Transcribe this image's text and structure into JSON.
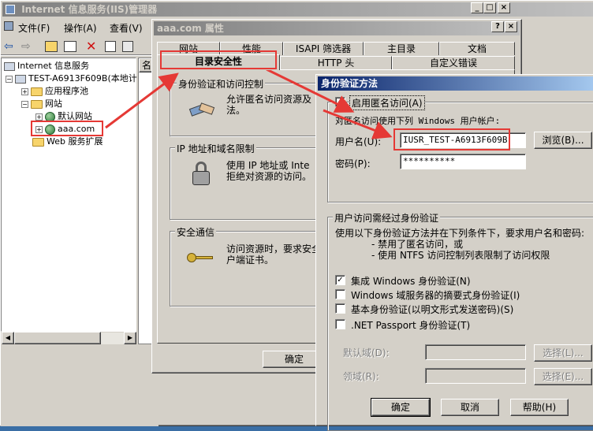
{
  "main_window": {
    "title": "Internet 信息服务(IIS)管理器",
    "menu": [
      "文件(F)",
      "操作(A)",
      "查看(V)"
    ],
    "tree": [
      {
        "label": "Internet 信息服务",
        "level": 0
      },
      {
        "label": "TEST-A6913F609B(本地计",
        "level": 1
      },
      {
        "label": "应用程序池",
        "level": 2
      },
      {
        "label": "网站",
        "level": 2
      },
      {
        "label": "默认网站",
        "level": 3
      },
      {
        "label": "aaa.com",
        "level": 3
      },
      {
        "label": "Web 服务扩展",
        "level": 2
      }
    ],
    "list_header": "名"
  },
  "props": {
    "title": "aaa.com 属性",
    "tabs_back": [
      "网站",
      "性能",
      "ISAPI 筛选器",
      "主目录",
      "文档"
    ],
    "tabs_front": [
      "目录安全性",
      "HTTP 头",
      "自定义错误"
    ],
    "auth_group": "身份验证和访问控制",
    "auth_text": [
      "允许匿名访问资源及",
      "法。"
    ],
    "ip_group": "IP 地址和域名限制",
    "ip_text": [
      "使用 IP 地址或 Inte",
      "拒绝对资源的访问。"
    ],
    "sec_group": "安全通信",
    "sec_text": [
      "访问资源时，要求安全",
      "户端证书。"
    ],
    "ok": "确定"
  },
  "auth_dialog": {
    "title": "身份验证方法",
    "anon_check": "启用匿名访问(A)",
    "anon_desc": "对匿名访问使用下列 Windows 用户帐户:",
    "user_label": "用户名(U):",
    "user_value": "IUSR_TEST-A6913F609B",
    "browse": "浏览(B)...",
    "pwd_label": "密码(P):",
    "pwd_value": "**********",
    "auth_group": "用户访问需经过身份验证",
    "auth_desc": [
      "使用以下身份验证方法并在下列条件下，要求用户名和密码:",
      "- 禁用了匿名访问，或",
      "- 使用 NTFS 访问控制列表限制了访问权限"
    ],
    "methods": [
      {
        "label": "集成 Windows 身份验证(N)",
        "checked": true
      },
      {
        "label": "Windows 域服务器的摘要式身份验证(I)",
        "checked": false
      },
      {
        "label": "基本身份验证(以明文形式发送密码)(S)",
        "checked": false
      },
      {
        "label": ".NET Passport 身份验证(T)",
        "checked": false
      }
    ],
    "default_domain": "默认域(D):",
    "realm": "领域(R):",
    "select1": "选择(L)...",
    "select2": "选择(E)...",
    "ok": "确定",
    "cancel": "取消",
    "help": "帮助(H)"
  },
  "colors": {
    "highlight": "#e53935",
    "title_active": "#0a246a"
  }
}
